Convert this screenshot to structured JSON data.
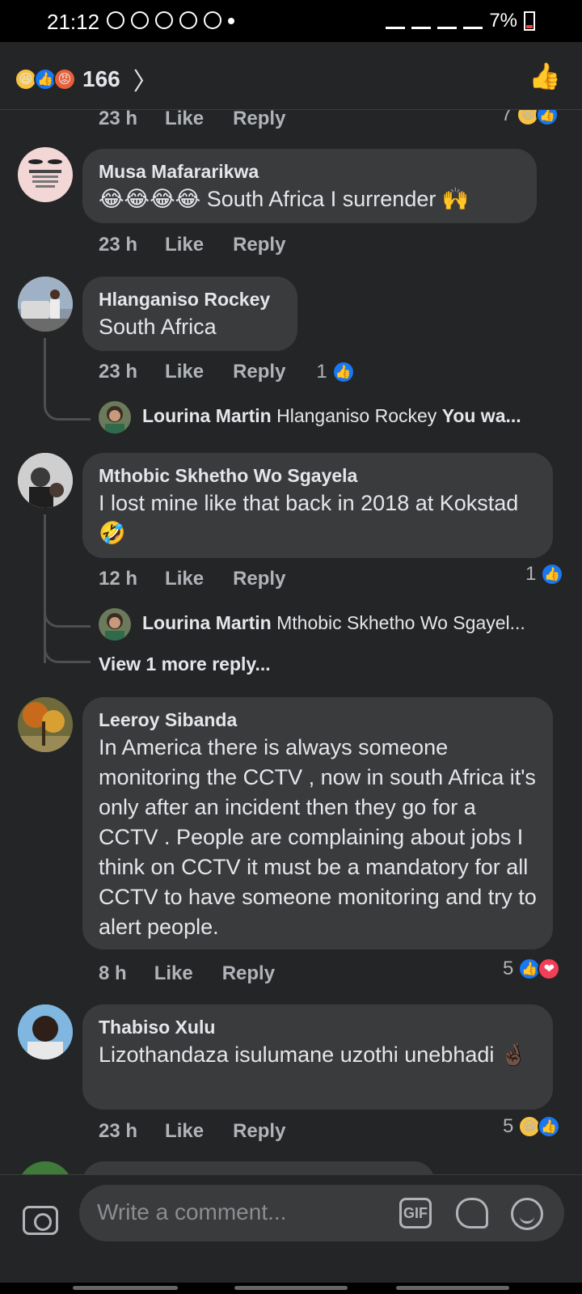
{
  "status_bar": {
    "time": "21:12",
    "battery": "7%"
  },
  "header": {
    "reaction_count": "166"
  },
  "comments": [
    {
      "meta": {
        "time": "23 h",
        "like": "Like",
        "reply": "Reply"
      },
      "reactions": {
        "count": "7"
      }
    },
    {
      "author": "Musa Mafararikwa",
      "text": "😂😂😂😂 South Africa I surrender 🙌",
      "meta": {
        "time": "23 h",
        "like": "Like",
        "reply": "Reply"
      },
      "avatar_text": "Whenever you do not understand what's happening in your life, just close your eyes, take a deep breath and say"
    },
    {
      "author": "Hlanganiso Rockey",
      "text": "South Africa",
      "meta": {
        "time": "23 h",
        "like": "Like",
        "reply": "Reply"
      },
      "reactions": {
        "count": "1"
      },
      "reply_preview": {
        "author": "Lourina Martin",
        "mention": "Hlanganiso Rockey",
        "text": "You wa..."
      }
    },
    {
      "author": "Mthobic Skhetho Wo Sgayela",
      "text": "I lost mine like that back in 2018 at Kokstad 🤣",
      "meta": {
        "time": "12 h",
        "like": "Like",
        "reply": "Reply"
      },
      "reactions": {
        "count": "1"
      },
      "reply_preview": {
        "author": "Lourina Martin",
        "mention": "Mthobic Skhetho Wo Sgayel..."
      },
      "view_more": "View 1 more reply..."
    },
    {
      "author": "Leeroy Sibanda",
      "text": "In America there is always someone monitoring the CCTV ,  now in south Africa it's only after an incident then they go for a CCTV . People are complaining about jobs I think on CCTV it must be a mandatory for all CCTV to have someone monitoring and try to alert people.",
      "meta": {
        "time": "8 h",
        "like": "Like",
        "reply": "Reply"
      },
      "reactions": {
        "count": "5"
      }
    },
    {
      "author": "Thabiso Xulu",
      "text": "Lizothandaza isulumane uzothi unebhadi 🤞🏿",
      "meta": {
        "time": "23 h",
        "like": "Like",
        "reply": "Reply"
      },
      "reactions": {
        "count": "5"
      }
    }
  ],
  "composer": {
    "placeholder": "Write a comment...",
    "gif_label": "GIF"
  },
  "icons": {
    "haha": "😆",
    "like": "👍",
    "angry": "😡",
    "love": "❤"
  }
}
